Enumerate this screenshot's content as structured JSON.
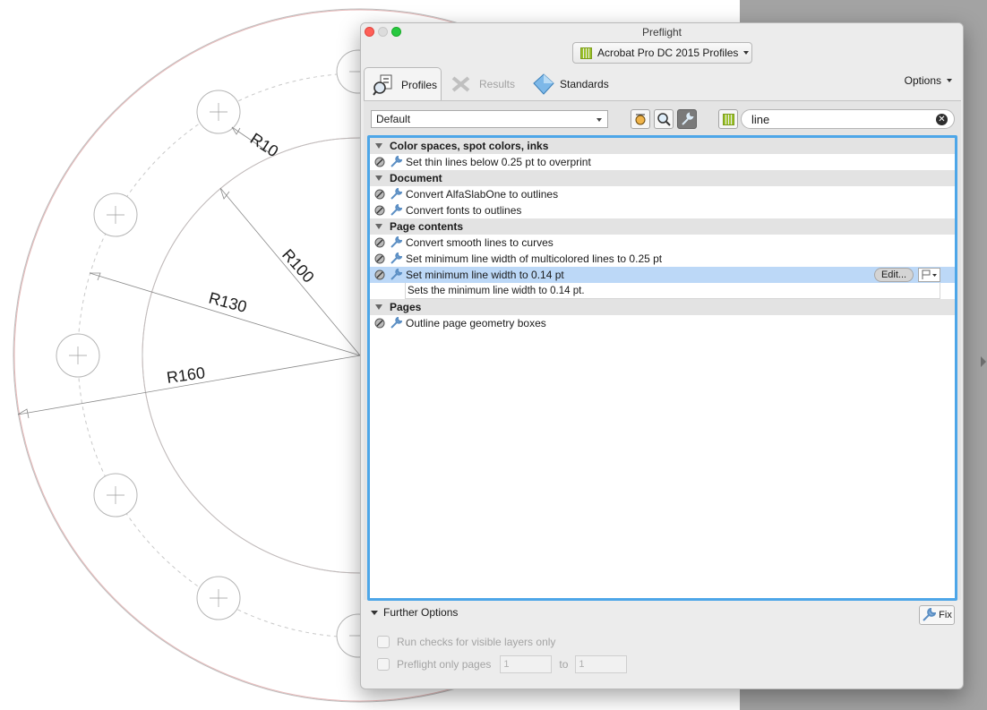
{
  "drawing": {
    "labels": [
      "R10",
      "R100",
      "R130",
      "R160"
    ]
  },
  "window": {
    "title": "Preflight",
    "profile_selector": "Acrobat Pro DC 2015 Profiles"
  },
  "tabs": [
    {
      "label": "Profiles",
      "icon": "profiles-magnifier-icon",
      "selected": true
    },
    {
      "label": "Results",
      "icon": "results-wrench-icon",
      "enabled": false
    },
    {
      "label": "Standards",
      "icon": "standards-diamond-icon"
    }
  ],
  "options_menu": "Options",
  "filter": {
    "group_dropdown": "Default",
    "search_value": "line"
  },
  "categories": [
    {
      "name": "Color spaces, spot colors, inks",
      "items": [
        "Set thin lines below 0.25 pt to overprint"
      ]
    },
    {
      "name": "Document",
      "items": [
        "Convert AlfaSlabOne to outlines",
        "Convert fonts to outlines"
      ]
    },
    {
      "name": "Page contents",
      "items": [
        "Convert smooth lines to curves",
        "Set minimum line width of multicolored lines to 0.25 pt",
        "Set minimum line width to 0.14 pt"
      ],
      "selected_item": "Set minimum line width to 0.14 pt",
      "selected_description": "Sets the  minimum line width to 0.14 pt.",
      "edit_label": "Edit..."
    },
    {
      "name": "Pages",
      "items": [
        "Outline page geometry boxes"
      ]
    }
  ],
  "footer": {
    "further_options": "Further Options",
    "fix_label": "Fix",
    "visible_layers_label": "Run checks for visible layers only",
    "pages_only_label": "Preflight only pages",
    "from_page": "1",
    "to_label": "to",
    "to_page": "1"
  },
  "colors": {
    "accent_blue": "#4da6e8",
    "selection": "#bcd8f7",
    "library_green": "#9bc12b"
  }
}
